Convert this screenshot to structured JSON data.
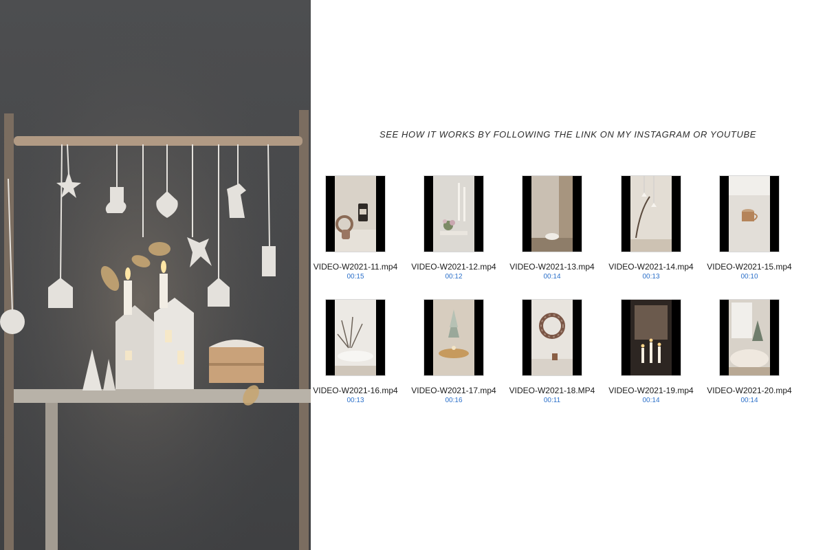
{
  "headline": "SEE HOW IT WORKS BY FOLLOWING THE LINK ON MY INSTAGRAM OR YOUTUBE",
  "colors": {
    "link_blue": "#2a6fc9",
    "photo_wall": "#4a4b4d"
  },
  "videos": [
    {
      "name": "VIDEO-W2021-11.mp4",
      "duration": "00:15",
      "scene": "headphones-and-candle"
    },
    {
      "name": "VIDEO-W2021-12.mp4",
      "duration": "00:12",
      "scene": "candles-and-flowers"
    },
    {
      "name": "VIDEO-W2021-13.mp4",
      "duration": "00:14",
      "scene": "bowl-on-shelf"
    },
    {
      "name": "VIDEO-W2021-14.mp4",
      "duration": "00:13",
      "scene": "hanging-ornament-branch"
    },
    {
      "name": "VIDEO-W2021-15.mp4",
      "duration": "00:10",
      "scene": "cup-on-table"
    },
    {
      "name": "VIDEO-W2021-16.mp4",
      "duration": "00:13",
      "scene": "white-branches-table"
    },
    {
      "name": "VIDEO-W2021-17.mp4",
      "duration": "00:16",
      "scene": "mini-tree-tray"
    },
    {
      "name": "VIDEO-W2021-18.MP4",
      "duration": "00:11",
      "scene": "wreath-on-wall"
    },
    {
      "name": "VIDEO-W2021-19.mp4",
      "duration": "00:14",
      "scene": "window-candles"
    },
    {
      "name": "VIDEO-W2021-20.mp4",
      "duration": "00:14",
      "scene": "tree-by-window"
    }
  ]
}
